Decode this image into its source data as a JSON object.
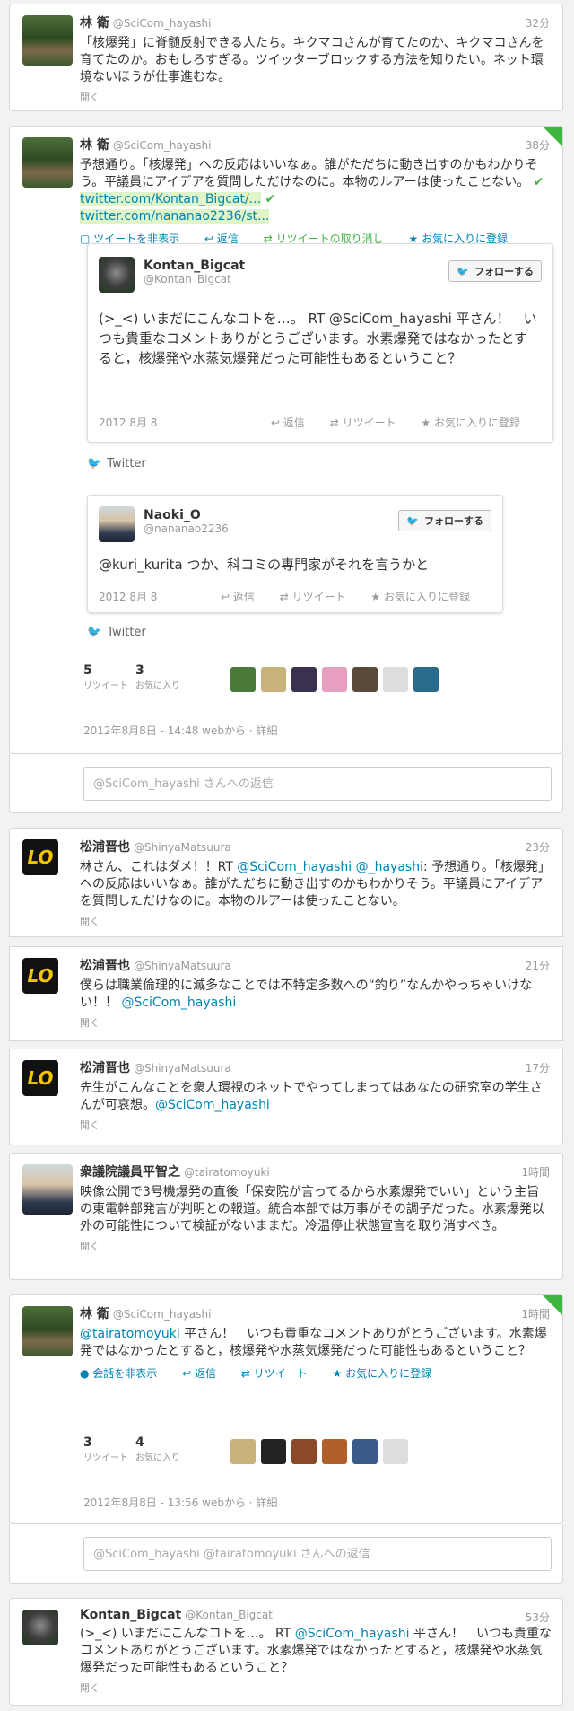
{
  "t1": {
    "name": "林 衛",
    "handle": "@SciCom_hayashi",
    "time": "32分",
    "text": "「核爆発」に脊髄反射できる人たち。キクマコさんが育てたのか、キクマコさんを育てたのか。おもしろすぎる。ツイッターブロックする方法を知りたい。ネット環境ないほうが仕事進むな。",
    "open": "開く"
  },
  "t2": {
    "name": "林 衛",
    "handle": "@SciCom_hayashi",
    "time": "38分",
    "text": "予想通り。「核爆発」への反応はいいなぁ。誰がただちに動き出すのかもわかりそう。平議員にアイデアを質問しただけなのに。本物のルアーは使ったことない。",
    "link1": "twitter.com/Kontan_Bigcat/...",
    "link2": "twitter.com/nananao2236/st...",
    "actions": [
      "ツイートを非表示",
      "返信",
      "リツイートの取り消し",
      "お気に入りに登録"
    ]
  },
  "e1": {
    "name": "Kontan_Bigcat",
    "handle": "@Kontan_Bigcat",
    "follow": "フォローする",
    "text": "(>_<) いまだにこんなコトを…。 RT @SciCom_hayashi 平さん！　いつも貴重なコメントありがとうございます。水素爆発ではなかったとすると，核爆発や水蒸気爆発だった可能性もあるということ？",
    "date": "2012 8月 8",
    "actions": [
      "返信",
      "リツイート",
      "お気に入りに登録"
    ],
    "brand": "Twitter"
  },
  "e2": {
    "name": "Naoki_O",
    "handle": "@nananao2236",
    "follow": "フォローする",
    "text": "@kuri_kurita つか、科コミの専門家がそれを言うかと",
    "date": "2012 8月 8",
    "actions": [
      "返信",
      "リツイート",
      "お気に入りに登録"
    ],
    "brand": "Twitter"
  },
  "s1": {
    "rt_n": "5",
    "rt_l": "リツイート",
    "fav_n": "3",
    "fav_l": "お気に入り",
    "meta": "2012年8月8日 - 14:48 webから · 詳細",
    "reply": "@SciCom_hayashi さんへの返信"
  },
  "t3": {
    "name": "松浦晋也",
    "handle": "@ShinyaMatsuura",
    "time": "23分",
    "pre": "林さん、これはダメ！！RT ",
    "m1": "@SciCom_hayashi",
    "m2": "@_hayashi",
    "post": ": 予想通り。「核爆発」への反応はいいなぁ。誰がただちに動き出すのかもわかりそう。平議員にアイデアを質問しただけなのに。本物のルアーは使ったことない。",
    "open": "開く"
  },
  "t4": {
    "name": "松浦晋也",
    "handle": "@ShinyaMatsuura",
    "time": "21分",
    "text": "僕らは職業倫理的に滅多なことでは不特定多数への“釣り”なんかやっちゃいけない！！",
    "mention": "@SciCom_hayashi",
    "open": "開く"
  },
  "t5": {
    "name": "松浦晋也",
    "handle": "@ShinyaMatsuura",
    "time": "17分",
    "text": "先生がこんなことを衆人環視のネットでやってしまってはあなたの研究室の学生さんが可哀想。",
    "mention": "@SciCom_hayashi",
    "open": "開く"
  },
  "t6": {
    "name": "衆議院議員平智之",
    "handle": "@tairatomoyuki",
    "time": "1時間",
    "text": "映像公開で3号機爆発の直後「保安院が言ってるから水素爆発でいい」という主旨の東電幹部発言が判明との報道。統合本部では万事がその調子だった。水素爆発以外の可能性について検証がないままだ。冷温停止状態宣言を取り消すべき。",
    "open": "開く"
  },
  "t7": {
    "name": "林 衛",
    "handle": "@SciCom_hayashi",
    "time": "1時間",
    "mention": "@tairatomoyuki",
    "text": " 平さん！　いつも貴重なコメントありがとうございます。水素爆発ではなかったとすると，核爆発や水蒸気爆発だった可能性もあるということ？",
    "actions": [
      "会話を非表示",
      "返信",
      "リツイート",
      "お気に入りに登録"
    ]
  },
  "s2": {
    "rt_n": "3",
    "rt_l": "リツイート",
    "fav_n": "4",
    "fav_l": "お気に入り",
    "meta": "2012年8月8日 - 13:56 webから · 詳細",
    "reply": "@SciCom_hayashi @tairatomoyuki さんへの返信"
  },
  "t8": {
    "name": "Kontan_Bigcat",
    "handle": "@Kontan_Bigcat",
    "time": "53分",
    "pre": "(>_<) いまだにこんなコトを…。 RT ",
    "mention": "@SciCom_hayashi",
    "post": " 平さん！　いつも貴重なコメントありがとうございます。水素爆発ではなかったとすると，核爆発や水蒸気爆発だった可能性もあるということ？",
    "open": "開く"
  },
  "colors": {
    "link": "#0084b4",
    "accent_green": "#3fb63f"
  }
}
